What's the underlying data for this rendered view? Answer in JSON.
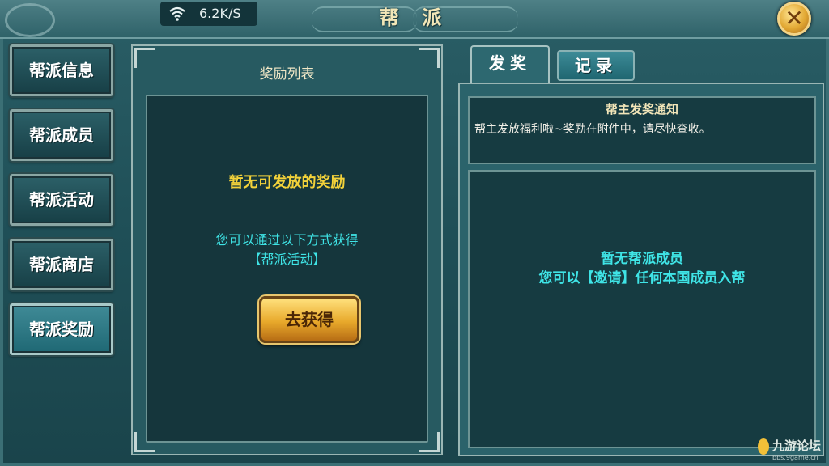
{
  "status_bar": {
    "speed": "6.2K/S"
  },
  "window": {
    "title": "帮 派",
    "close_icon": "close-x-icon"
  },
  "sidebar": {
    "items": [
      {
        "label": "帮派信息"
      },
      {
        "label": "帮派成员"
      },
      {
        "label": "帮派活动"
      },
      {
        "label": "帮派商店"
      },
      {
        "label": "帮派奖励"
      }
    ],
    "active_index": 4
  },
  "reward_list": {
    "heading": "奖励列表",
    "empty_title": "暂无可发放的奖励",
    "hint_line1": "您可以通过以下方式获得",
    "hint_line2": "【帮派活动】",
    "go_button": "去获得"
  },
  "tabs": [
    {
      "label": "发奖",
      "active": true
    },
    {
      "label": "记录",
      "active": false
    }
  ],
  "notice": {
    "title": "帮主发奖通知",
    "body": "帮主发放福利啦~奖励在附件中，请尽快查收。"
  },
  "members": {
    "empty_line1": "暂无帮派成员",
    "empty_line2": "您可以【邀请】任何本国成员入帮"
  },
  "watermark": {
    "name": "九游论坛",
    "url": "bbs.9game.cn"
  },
  "colors": {
    "accent_gold": "#f3d23a",
    "hint_cyan": "#3fe4e6",
    "panel_bg": "#15363c"
  }
}
